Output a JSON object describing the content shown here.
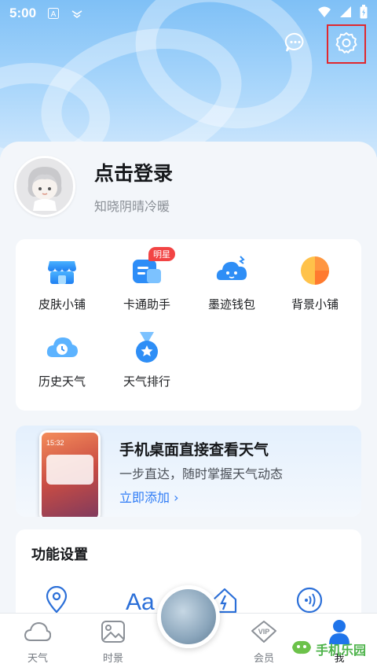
{
  "status_bar": {
    "time": "5:00"
  },
  "profile": {
    "title": "点击登录",
    "subtitle": "知晓阴晴冷暖"
  },
  "tools": [
    {
      "label": "皮肤小铺",
      "icon": "shop-icon"
    },
    {
      "label": "卡通助手",
      "icon": "cartoon-assistant-icon",
      "badge": "明星"
    },
    {
      "label": "墨迹钱包",
      "icon": "wallet-icon"
    },
    {
      "label": "背景小铺",
      "icon": "background-shop-icon"
    },
    {
      "label": "历史天气",
      "icon": "history-weather-icon"
    },
    {
      "label": "天气排行",
      "icon": "weather-rank-icon"
    }
  ],
  "promo": {
    "title": "手机桌面直接查看天气",
    "subtitle": "一步直达，随时掌握天气动态",
    "link": "立即添加 ›",
    "phone_time": "15:32"
  },
  "function_settings": {
    "title": "功能设置"
  },
  "bottom_nav": [
    {
      "label": "天气",
      "icon": "weather-cloud-icon"
    },
    {
      "label": "时景",
      "icon": "photo-icon"
    },
    {
      "label": "会员",
      "icon": "vip-icon"
    },
    {
      "label": "我",
      "icon": "user-icon"
    }
  ],
  "watermark": {
    "text": "手机乐园"
  },
  "colors": {
    "accent": "#2f7cf6",
    "badge": "#f24444",
    "highlight_border": "#e0282e"
  }
}
